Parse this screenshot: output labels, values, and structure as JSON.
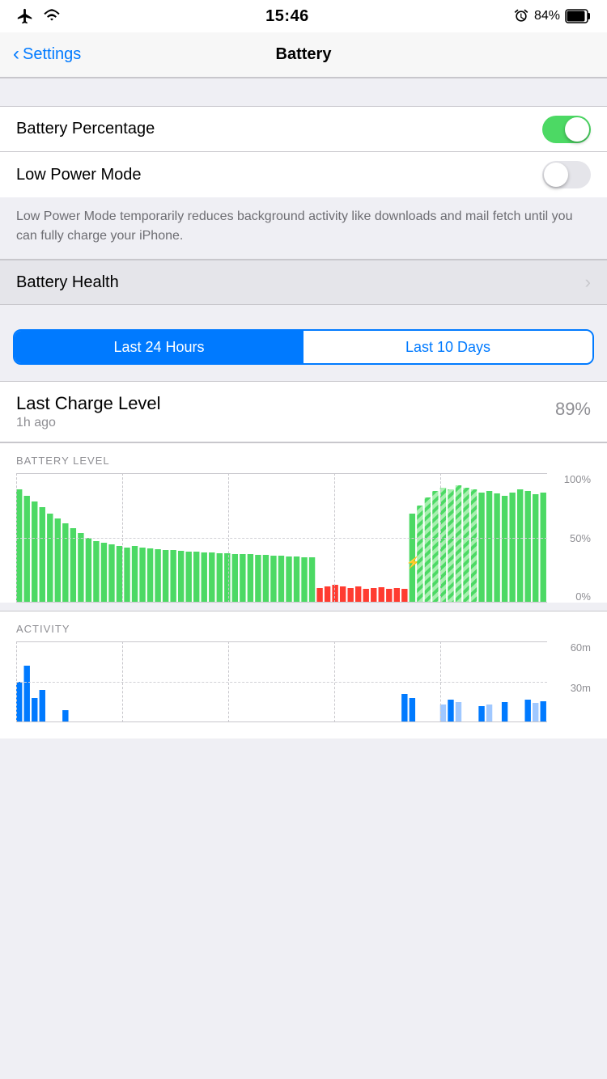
{
  "statusBar": {
    "time": "15:46",
    "battery": "84%"
  },
  "navBar": {
    "backLabel": "Settings",
    "title": "Battery"
  },
  "settings": {
    "batteryPercentage": {
      "label": "Battery Percentage",
      "on": true
    },
    "lowPowerMode": {
      "label": "Low Power Mode",
      "on": false
    },
    "lowPowerDescription": "Low Power Mode temporarily reduces background activity like downloads and mail fetch until you can fully charge your iPhone.",
    "batteryHealth": {
      "label": "Battery Health"
    }
  },
  "usageTabs": {
    "tab1": "Last 24 Hours",
    "tab2": "Last 10 Days",
    "activeTab": 0
  },
  "chargeLevel": {
    "title": "Last Charge Level",
    "timeAgo": "1h ago",
    "percentage": "89%"
  },
  "charts": {
    "batteryLevelLabel": "BATTERY LEVEL",
    "activityLabel": "ACTIVITY",
    "yLabels": [
      "100%",
      "50%",
      "0%"
    ],
    "activityYLabels": [
      "60m",
      "30m",
      ""
    ]
  }
}
